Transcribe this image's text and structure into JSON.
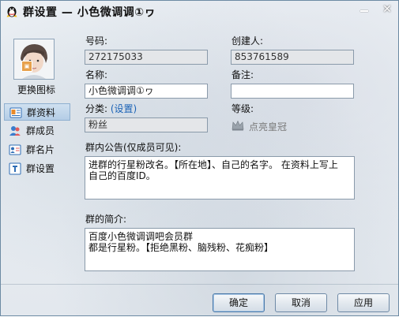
{
  "window": {
    "title": "群设置 — 小色微调调①ヮ",
    "icon": "qq-penguin-icon"
  },
  "sidebar": {
    "change_icon_label": "更换图标",
    "items": [
      {
        "label": "群资料",
        "icon": "group-info-icon",
        "active": true
      },
      {
        "label": "群成员",
        "icon": "group-members-icon",
        "active": false
      },
      {
        "label": "群名片",
        "icon": "group-card-icon",
        "active": false
      },
      {
        "label": "群设置",
        "icon": "group-settings-icon",
        "active": false
      }
    ]
  },
  "form": {
    "number_label": "号码:",
    "number_value": "272175033",
    "creator_label": "创建人:",
    "creator_value": "853761589",
    "name_label": "名称:",
    "name_value": "小色微调调①ヮ",
    "note_label": "备注:",
    "note_value": "",
    "category_label": "分类:",
    "category_link": "(设置)",
    "category_value": "粉丝",
    "level_label": "等级:",
    "level_value": "点亮皇冠",
    "notice_label": "群内公告(仅成员可见):",
    "notice_value": "进群的行星粉改名。【所在地】、自己的名字。 在资料上写上\n自己的百度ID。",
    "intro_label": "群的简介:",
    "intro_value": "百度小色微调调吧会员群\n都是行星粉。【拒绝黑粉、脑残粉、花痴粉】"
  },
  "buttons": {
    "ok": "确定",
    "cancel": "取消",
    "apply": "应用"
  },
  "colors": {
    "link": "#1a62b6",
    "active_nav": "#b4cde6"
  }
}
